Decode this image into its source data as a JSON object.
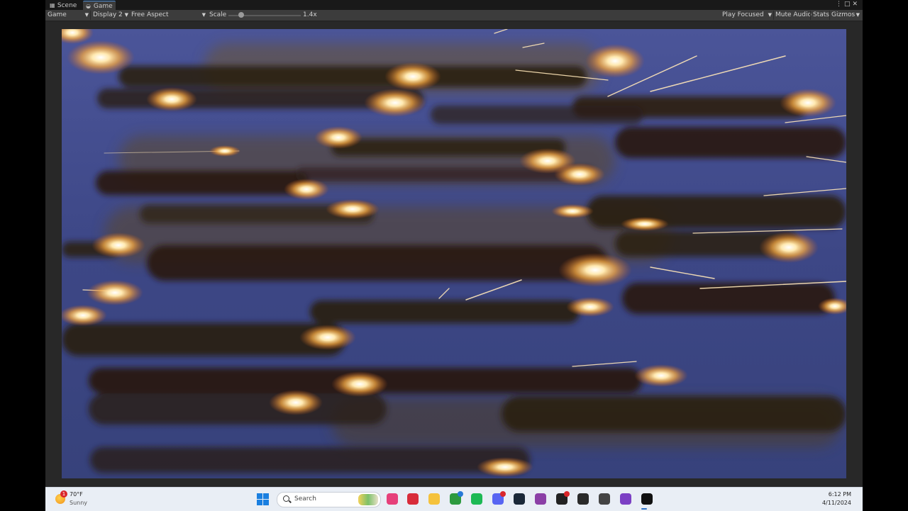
{
  "tabs": [
    {
      "label": "Scene",
      "icon": "grid-icon"
    },
    {
      "label": "Game",
      "icon": "gamepad-icon"
    }
  ],
  "window_icons": [
    "kebab-menu-icon",
    "maximize-icon",
    "close-icon"
  ],
  "toolbar": {
    "view_select": "Game",
    "display_select": "Display 2",
    "aspect_select": "Free Aspect",
    "scale_label": "Scale",
    "scale_value": "1.4x",
    "scale_fraction": 0.18,
    "play_mode": "Play Focused",
    "mute_audio": "Mute Audio",
    "stats": "Stats",
    "gizmos": "Gizmos"
  },
  "colors": {
    "tab_accent": "#4f8fd6",
    "sky": "#3f4b88",
    "smoke": "#2b1d14",
    "flare": "#ffd98a"
  },
  "taskbar": {
    "weather_temp": "70°F",
    "weather_condition": "Sunny",
    "weather_badge": "1",
    "search_placeholder": "Search",
    "apps": [
      {
        "name": "photos-app-icon",
        "color": "#e6407a"
      },
      {
        "name": "opera-icon",
        "color": "#d82c3a"
      },
      {
        "name": "file-explorer-icon",
        "color": "#f5c23c"
      },
      {
        "name": "xbox-icon",
        "color": "#2d9a3f"
      },
      {
        "name": "spotify-icon",
        "color": "#1db954"
      },
      {
        "name": "discord-icon",
        "color": "#5865f2"
      },
      {
        "name": "steam-icon",
        "color": "#1b2838"
      },
      {
        "name": "github-icon",
        "color": "#8b3fa6"
      },
      {
        "name": "chat-app-icon",
        "color": "#222222"
      },
      {
        "name": "epic-games-icon",
        "color": "#2a2a2a"
      },
      {
        "name": "unity-hub-icon",
        "color": "#444444"
      },
      {
        "name": "visual-studio-icon",
        "color": "#7b3fc4"
      },
      {
        "name": "unity-editor-icon",
        "color": "#111111"
      }
    ],
    "clock_time": "6:12 PM",
    "clock_date": "4/11/2024"
  }
}
